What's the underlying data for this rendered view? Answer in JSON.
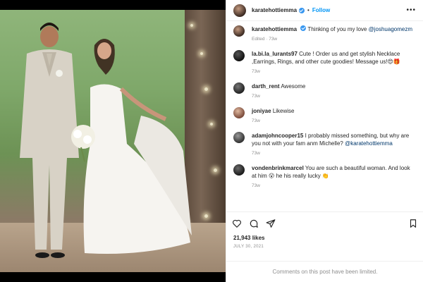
{
  "header": {
    "username": "karatehottiemma",
    "follow_label": "Follow",
    "dot": "•",
    "more_icon": "more-horizontal-icon"
  },
  "caption": {
    "username": "karatehottiemma",
    "text": "Thinking of you my love",
    "mention": "@joshuagomezm",
    "meta": "Edited · 73w"
  },
  "comments": [
    {
      "username": "la.bi.la_lurants97",
      "text": "Cute ! Order us and get stylish Necklace ,Earrings, Rings, and other cute goodies! Message us!😍🎁",
      "meta": "73w"
    },
    {
      "username": "darth_rent",
      "text": "Awesome",
      "meta": "73w"
    },
    {
      "username": "joniyae",
      "text": "Likewise",
      "meta": "73w"
    },
    {
      "username": "adamjohncooper15",
      "text": "I probably missed something, but why are you not with your fam anm Michelle?",
      "mention": "@karatehottiemma",
      "meta": "73w"
    },
    {
      "username": "vondenbrinkmarcel",
      "text": "You are such a beautiful woman. And look at him 😮 he his really lucky 👏",
      "meta": "73w"
    }
  ],
  "actions": {
    "like_icon": "heart-icon",
    "comment_icon": "comment-icon",
    "share_icon": "share-icon",
    "save_icon": "bookmark-icon"
  },
  "likes_text": "21,943 likes",
  "date_text": "JULY 30, 2021",
  "comments_limited_text": "Comments on this post have been limited.",
  "colors": {
    "link_blue": "#0095f6",
    "verified_blue": "#3897f0",
    "muted_gray": "#8e8e8e",
    "text": "#262626"
  }
}
